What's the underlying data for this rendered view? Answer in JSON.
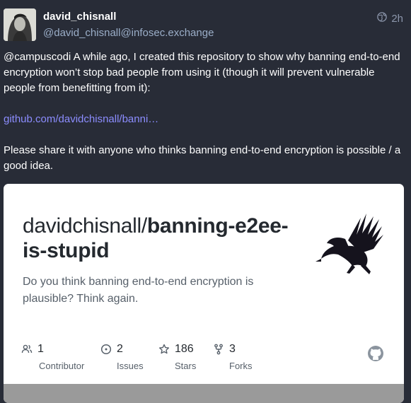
{
  "post": {
    "display_name": "david_chisnall",
    "handle": "@david_chisnall@infosec.exchange",
    "visibility_icon": "globe-icon",
    "timestamp": "2h",
    "mention": "@campuscodi",
    "text1": " A while ago, I created this repository to show why banning end-to-end encryption won’t stop bad people from using it (though it will prevent vulnerable people from benefitting from it):",
    "link": "github.com/davidchisnall/banni…",
    "text2": "Please share it with anyone who thinks banning end-to-end encryption is possible / a good idea."
  },
  "card": {
    "owner": "davidchisnall/",
    "repo": "banning-e2ee-is-stupid",
    "description": "Do you think banning end-to-end encryption is plausible? Think again.",
    "stats": [
      {
        "value": "1",
        "label": "Contributor",
        "icon": "contributors-icon"
      },
      {
        "value": "2",
        "label": "Issues",
        "icon": "issues-icon"
      },
      {
        "value": "186",
        "label": "Stars",
        "icon": "star-icon"
      },
      {
        "value": "3",
        "label": "Forks",
        "icon": "fork-icon"
      }
    ],
    "logo_icon": "github-icon"
  },
  "colors": {
    "background": "#282c37",
    "link": "#8c8dff",
    "handle": "#9baec8"
  }
}
